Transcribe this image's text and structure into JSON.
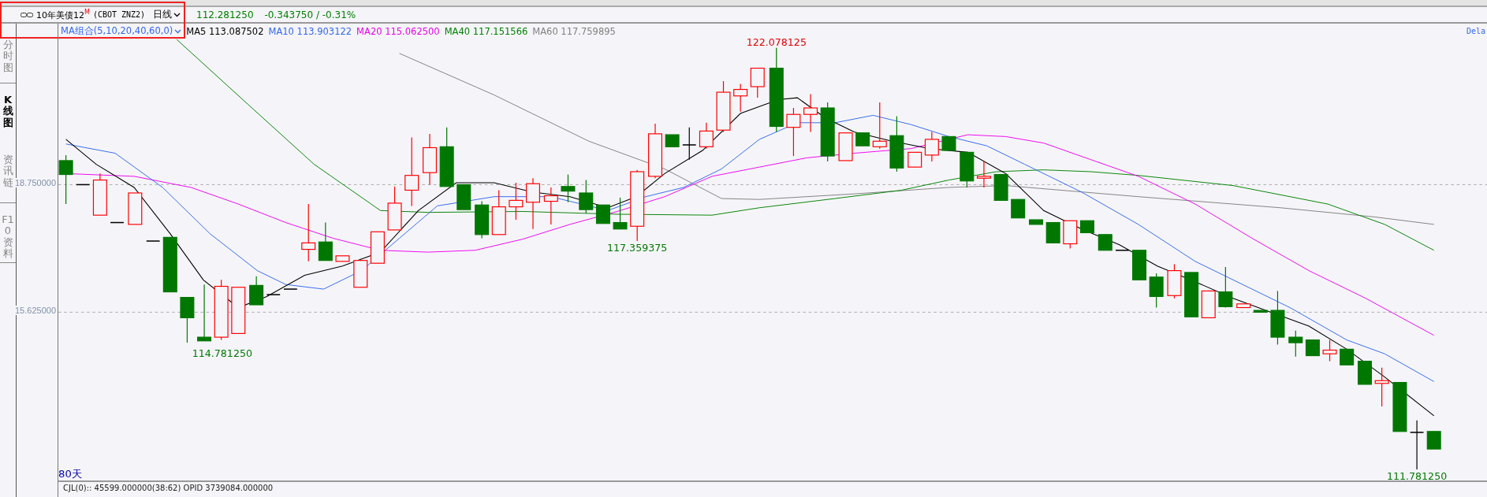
{
  "header": {
    "instrument": "10年美债12$^{M}$",
    "contract": "(CBOT ZNZ2)",
    "period": "日线",
    "price": "112.281250",
    "change": "-0.343750 / -0.31%"
  },
  "indicator": {
    "name": "MA组合(5,10,20,40,60,0)",
    "values": [
      {
        "label": "MA5 113.087502",
        "color": "#000000"
      },
      {
        "label": "MA10 113.903122",
        "color": "#3366ee"
      },
      {
        "label": "MA20 115.062500",
        "color": "#ee00ee"
      },
      {
        "label": "MA40 117.151566",
        "color": "#008000"
      },
      {
        "label": "MA60 117.759895",
        "color": "#808080"
      }
    ]
  },
  "sidebar": {
    "tabs": [
      {
        "label": "分时图",
        "selected": false
      },
      {
        "label": "K线图",
        "selected": true
      },
      {
        "label": "资讯链",
        "selected": false
      },
      {
        "label": "F10资料",
        "selected": false
      }
    ]
  },
  "axis": {
    "price_labels": [
      "18.750000",
      "15.625000"
    ]
  },
  "chart": {
    "annotations": [
      {
        "text": "122.078125",
        "kind": "high"
      },
      {
        "text": "117.359375",
        "kind": "low"
      },
      {
        "text": "114.781250",
        "kind": "low"
      },
      {
        "text": "111.781250",
        "kind": "low"
      }
    ],
    "range": "80天",
    "note": "Dela"
  },
  "footer": {
    "text": "CJL(0):: 45599.000000(38:62)  OPID 3739084.000000"
  }
}
